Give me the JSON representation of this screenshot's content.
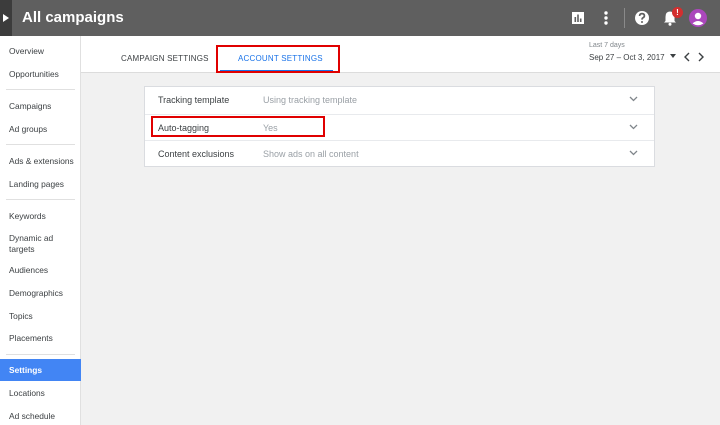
{
  "app": {
    "title": "All campaigns",
    "notification_count": "!"
  },
  "sidebar": {
    "items": [
      {
        "label": "Overview"
      },
      {
        "label": "Opportunities"
      },
      {
        "label": "Campaigns"
      },
      {
        "label": "Ad groups"
      },
      {
        "label": "Ads & extensions"
      },
      {
        "label": "Landing pages"
      },
      {
        "label": "Keywords"
      },
      {
        "label": "Dynamic ad targets"
      },
      {
        "label": "Audiences"
      },
      {
        "label": "Demographics"
      },
      {
        "label": "Topics"
      },
      {
        "label": "Placements"
      },
      {
        "label": "Settings"
      },
      {
        "label": "Locations"
      },
      {
        "label": "Ad schedule"
      }
    ],
    "active": "Settings"
  },
  "tabs": [
    {
      "label": "CAMPAIGN SETTINGS"
    },
    {
      "label": "ACCOUNT SETTINGS"
    }
  ],
  "date": {
    "label": "Last 7 days",
    "range": "Sep 27 – Oct 3, 2017"
  },
  "settings": [
    {
      "label": "Tracking template",
      "value": "Using tracking template"
    },
    {
      "label": "Auto-tagging",
      "value": "Yes"
    },
    {
      "label": "Content exclusions",
      "value": "Show ads on all content"
    }
  ],
  "icons": {
    "expander": "triangle-right-icon",
    "reports": "bar-chart-icon",
    "more": "more-vert-icon",
    "help": "help-icon",
    "notifications": "bell-icon",
    "account": "avatar-icon",
    "expand_row": "chevron-down-icon"
  },
  "colors": {
    "accent": "#4285f4",
    "tab_active": "#1a73e8",
    "highlight": "#e00000",
    "avatar": "#ab47bc",
    "badge": "#d32f2f"
  }
}
